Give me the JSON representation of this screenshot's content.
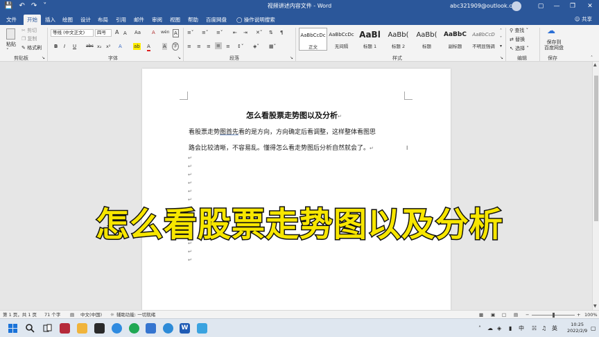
{
  "window": {
    "title": "视频讲述内容文件 - Word",
    "account": "abc321909@outlook.com",
    "avatar_initials": "A"
  },
  "qat": {
    "autosave_icon": "save-icon",
    "undo_icon": "undo-icon",
    "redo_icon": "redo-icon",
    "more_icon": "chevron-down-icon"
  },
  "tabs": [
    "文件",
    "开始",
    "插入",
    "绘图",
    "设计",
    "布局",
    "引用",
    "邮件",
    "审阅",
    "视图",
    "帮助",
    "百度网盘",
    "操作说明搜索"
  ],
  "tabs_active": "开始",
  "share_label": "共享",
  "ribbon": {
    "clipboard": {
      "paste": "粘贴",
      "cut": "剪切",
      "copy": "复制",
      "format_painter": "格式刷",
      "group": "剪贴板"
    },
    "font": {
      "font_name": "等线 (中文正文)",
      "font_size": "四号",
      "group": "字体",
      "bold": "B",
      "italic": "I",
      "underline": "U",
      "strikethrough": "abc",
      "subscript": "x₂",
      "superscript": "x²",
      "grow": "A",
      "shrink": "A",
      "case": "Aa",
      "clear": "A",
      "phonetic": "wén",
      "border_char": "A",
      "highlight": "ab",
      "font_color": "A",
      "shading": "A",
      "circle": "字"
    },
    "paragraph": {
      "group": "段落"
    },
    "styles": {
      "group": "样式",
      "items": [
        {
          "sample": "AaBbCcDc",
          "name": "正文"
        },
        {
          "sample": "AaBbCcDc",
          "name": "无间隔"
        },
        {
          "sample": "AaBl",
          "name": "标题 1"
        },
        {
          "sample": "AaBb(",
          "name": "标题 2"
        },
        {
          "sample": "AaBb(",
          "name": "标题"
        },
        {
          "sample": "AaBbC",
          "name": "副标题"
        },
        {
          "sample": "AaBbCcD",
          "name": "不明显强调"
        }
      ]
    },
    "editing": {
      "group": "编辑",
      "find": "查找",
      "replace": "替换",
      "select": "选择"
    },
    "save": {
      "group": "保存",
      "label_line1": "保存到",
      "label_line2": "百度网盘"
    }
  },
  "document": {
    "title": "怎么看股票走势图以及分析",
    "line1_a": "看股票走势",
    "line1_u": "图首先",
    "line1_b": "看的是方向，方向确定后看调整，这样整体看图思",
    "line2": "路会比较清晰，不容易乱。懂得怎么看走势图后分析自然就会了。",
    "para_mark": "↵"
  },
  "overlay_text": "怎么看股票走势图以及分析",
  "status": {
    "page": "第 1 页，共 1 页",
    "words": "71 个字",
    "language": "中文(中国)",
    "accessibility": "辅助功能: 一切就绪",
    "zoom": "100%"
  },
  "taskbar": {
    "time": "10:25",
    "date": "2022/2/9",
    "ime": "中",
    "ime2": "英"
  }
}
